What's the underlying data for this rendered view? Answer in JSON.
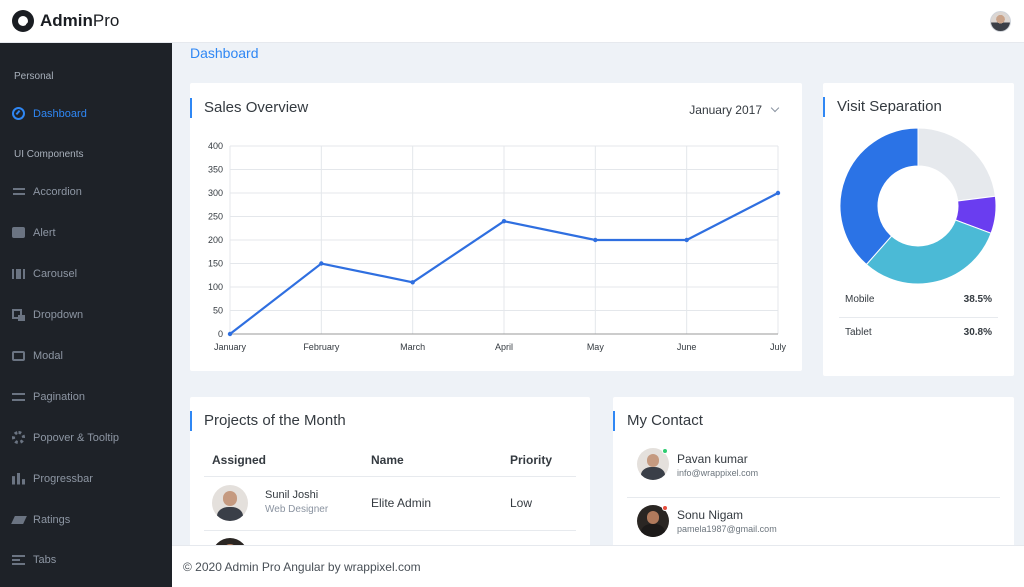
{
  "brand": {
    "bold": "Admin",
    "light": "Pro"
  },
  "sidebar": {
    "section_personal": "Personal",
    "section_ui": "UI Components",
    "items": [
      {
        "label": "Dashboard",
        "icon": "dashboard-icon"
      },
      {
        "label": "Accordion",
        "icon": "accordion-icon"
      },
      {
        "label": "Alert",
        "icon": "alert-icon"
      },
      {
        "label": "Carousel",
        "icon": "carousel-icon"
      },
      {
        "label": "Dropdown",
        "icon": "dropdown-icon"
      },
      {
        "label": "Modal",
        "icon": "modal-icon"
      },
      {
        "label": "Pagination",
        "icon": "pagination-icon"
      },
      {
        "label": "Popover & Tooltip",
        "icon": "gear-icon"
      },
      {
        "label": "Progressbar",
        "icon": "progressbar-icon"
      },
      {
        "label": "Ratings",
        "icon": "ratings-icon"
      },
      {
        "label": "Tabs",
        "icon": "tabs-icon"
      }
    ]
  },
  "breadcrumb": "Dashboard",
  "sales": {
    "title": "Sales Overview",
    "month": "January 2017",
    "chart_data": {
      "type": "line",
      "categories": [
        "January",
        "February",
        "March",
        "April",
        "May",
        "June",
        "July"
      ],
      "values": [
        0,
        150,
        110,
        240,
        200,
        200,
        300
      ],
      "yticks": [
        0,
        50,
        100,
        150,
        200,
        250,
        300,
        350,
        400
      ],
      "ylim": [
        0,
        400
      ],
      "grid": true,
      "color": "#2f6fe0"
    }
  },
  "visit": {
    "title": "Visit Separation",
    "chart_data": {
      "type": "pie",
      "slices": [
        {
          "value": 38.5,
          "color": "#2b73e6"
        },
        {
          "value": 30.8,
          "color": "#4bbad6"
        },
        {
          "value": 7.7,
          "color": "#6a3df0"
        },
        {
          "value": 23.0,
          "color": "#e6e9ed"
        }
      ]
    },
    "legend": [
      {
        "label": "Mobile",
        "value": "38.5%"
      },
      {
        "label": "Tablet",
        "value": "30.8%"
      }
    ]
  },
  "projects": {
    "title": "Projects of the Month",
    "headers": {
      "assigned": "Assigned",
      "name": "Name",
      "priority": "Priority"
    },
    "rows": [
      {
        "person": "Sunil Joshi",
        "role": "Web Designer",
        "name": "Elite Admin",
        "priority": "Low"
      }
    ]
  },
  "contact": {
    "title": "My Contact",
    "people": [
      {
        "name": "Pavan kumar",
        "email": "info@wrappixel.com",
        "status_color": "#2ecc71"
      },
      {
        "name": "Sonu Nigam",
        "email": "pamela1987@gmail.com",
        "status_color": "#e74c3c"
      }
    ]
  },
  "footer": "© 2020 Admin Pro Angular by wrappixel.com"
}
